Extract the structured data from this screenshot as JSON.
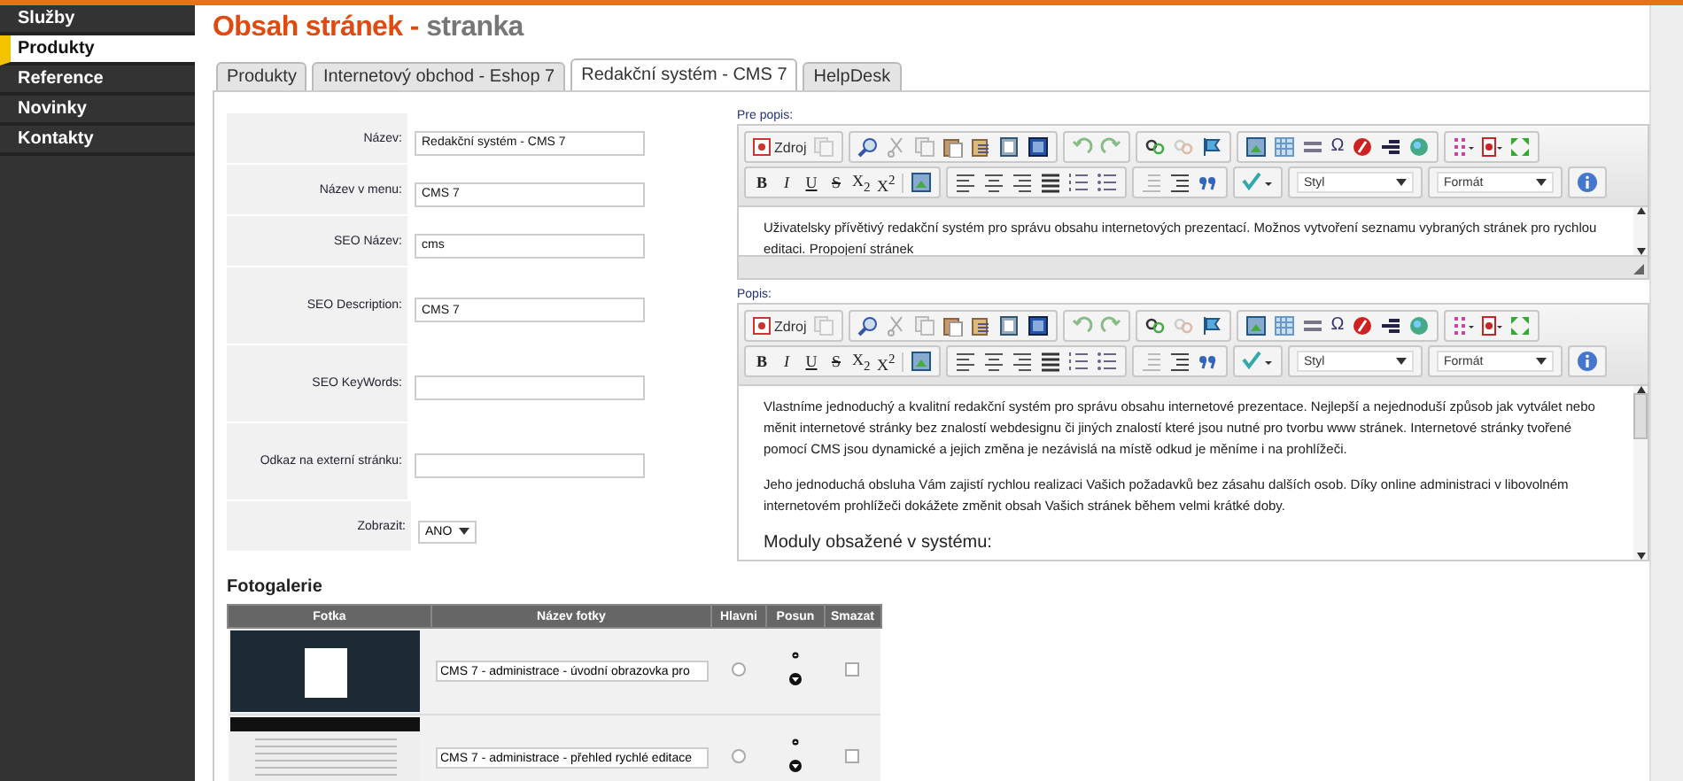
{
  "sidebar": {
    "items": [
      {
        "label": "Služby",
        "selected": false
      },
      {
        "label": "Produkty",
        "selected": true
      },
      {
        "label": "Reference",
        "selected": false
      },
      {
        "label": "Novinky",
        "selected": false
      },
      {
        "label": "Kontakty",
        "selected": false
      }
    ]
  },
  "page_title": {
    "main": "Obsah stránek - ",
    "sub": "stranka"
  },
  "tabs": [
    {
      "label": "Produkty",
      "selected": false
    },
    {
      "label": "Internetový obchod - Eshop 7",
      "selected": false
    },
    {
      "label": "Redakční systém - CMS 7",
      "selected": true
    },
    {
      "label": "HelpDesk",
      "selected": false
    }
  ],
  "form": {
    "fields": [
      {
        "label": "Název:",
        "value": "Redakční systém - CMS 7",
        "kind": "text"
      },
      {
        "label": "Název v menu:",
        "value": "CMS 7",
        "kind": "text"
      },
      {
        "label": "SEO Název:",
        "value": "cms",
        "kind": "text"
      },
      {
        "label": "SEO Description:",
        "value": "CMS 7",
        "kind": "text"
      },
      {
        "label": "SEO KeyWords:",
        "kind": "text"
      },
      {
        "label": "Odkaz na externí stránku:",
        "kind": "text"
      },
      {
        "label": "Zobrazit:",
        "value": "ANO",
        "kind": "select"
      }
    ]
  },
  "editors": [
    {
      "label": "Pre popis:",
      "toolbar": {
        "source": "Zdroj",
        "omega": "Ω",
        "marks": [
          {
            "text": "B",
            "kind": "bold"
          },
          {
            "text": "I",
            "kind": "italic"
          },
          {
            "text": "U",
            "kind": "underline"
          },
          {
            "text": "S",
            "kind": "strike"
          },
          {
            "text": "X$_{2}$",
            "kind": "plain"
          },
          {
            "text": "X$^{2}$",
            "kind": "plain"
          }
        ],
        "style_select": "Styl",
        "format_select": "Formát"
      },
      "content": [
        {
          "kind": "paragraph",
          "text": "Uživatelsky přívětivý redakční systém pro správu obsahu internetových prezentací. Možnos vytvoření seznamu vybraných stránek pro rychlou editaci. Propojení stránek"
        }
      ]
    },
    {
      "label": "Popis:",
      "toolbar": {
        "source": "Zdroj",
        "omega": "Ω",
        "marks": [
          {
            "text": "B",
            "kind": "bold"
          },
          {
            "text": "I",
            "kind": "italic"
          },
          {
            "text": "U",
            "kind": "underline"
          },
          {
            "text": "S",
            "kind": "strike"
          },
          {
            "text": "X$_{2}$",
            "kind": "plain"
          },
          {
            "text": "X$^{2}$",
            "kind": "plain"
          }
        ],
        "style_select": "Styl",
        "format_select": "Formát"
      },
      "content": [
        {
          "kind": "paragraph",
          "text": "Vlastníme jednoduchý a kvalitní redakční systém pro správu obsahu internetové prezentace. Nejlepší a nejednoduší způsob jak vytválet nebo měnit internetové stránky bez znalostí webdesignu či jiných znalostí které jsou nutné pro tvorbu www stránek. Internetové stránky tvořené pomocí CMS jsou dynamické a jejich změna je nezávislá na místě odkud je měníme i na prohlížeči."
        },
        {
          "kind": "paragraph",
          "text": "Jeho jednoduchá obsluha Vám zajistí rychlou realizaci Vašich požadavků bez zásahu dalších osob. Díky online administraci v libovolném internetovém prohlížeči dokážete změnit obsah Vašich stránek během velmi krátké doby."
        },
        {
          "kind": "heading",
          "text": "Moduly obsažené v systému:"
        }
      ]
    }
  ],
  "gallery": {
    "title": "Fotogalerie",
    "columns": [
      "Fotka",
      "Název fotky",
      "Hlavni",
      "Posun",
      "Smazat"
    ],
    "rows": [
      {
        "caption": "CMS 7 - administrace - úvodní obrazovka pro",
        "kind": "login",
        "main": false,
        "delete": false
      },
      {
        "caption": "CMS 7 - administrace - přehled rychlé editace",
        "kind": "list",
        "main": false,
        "delete": false
      }
    ]
  }
}
